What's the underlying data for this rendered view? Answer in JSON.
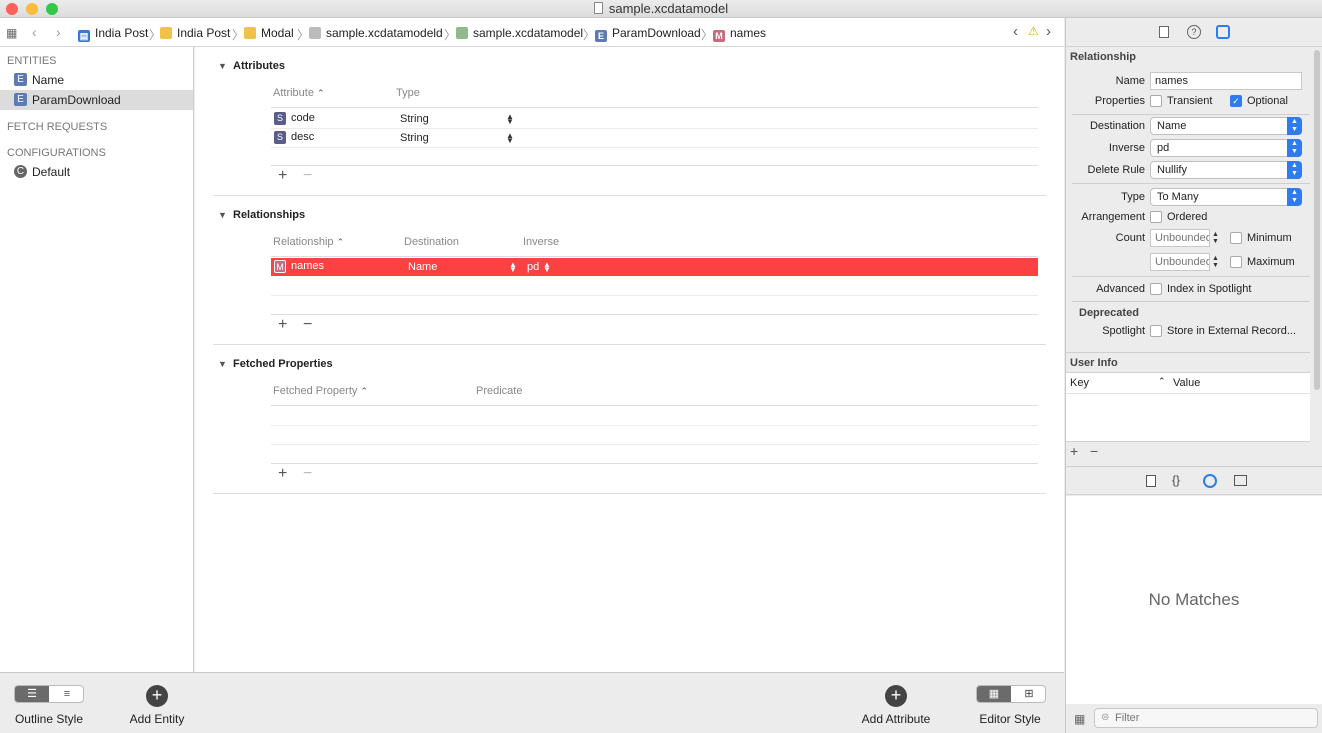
{
  "window": {
    "title": "sample.xcdatamodel"
  },
  "breadcrumbs": [
    "India Post",
    "India Post",
    "Modal",
    "sample.xcdatamodeld",
    "sample.xcdatamodel",
    "ParamDownload",
    "names"
  ],
  "sidebar": {
    "entities_header": "ENTITIES",
    "entities": [
      {
        "label": "Name",
        "icon": "E"
      },
      {
        "label": "ParamDownload",
        "icon": "E"
      }
    ],
    "fetch_requests_header": "FETCH REQUESTS",
    "configurations_header": "CONFIGURATIONS",
    "configurations": [
      {
        "label": "Default",
        "icon": "C"
      }
    ]
  },
  "attributes": {
    "title": "Attributes",
    "col_attribute": "Attribute",
    "col_type": "Type",
    "rows": [
      {
        "icon": "S",
        "name": "code",
        "type": "String"
      },
      {
        "icon": "S",
        "name": "desc",
        "type": "String"
      }
    ]
  },
  "relationships": {
    "title": "Relationships",
    "col_relationship": "Relationship",
    "col_destination": "Destination",
    "col_inverse": "Inverse",
    "rows": [
      {
        "icon": "M",
        "name": "names",
        "destination": "Name",
        "inverse": "pd"
      }
    ]
  },
  "fetched": {
    "title": "Fetched Properties",
    "col_property": "Fetched Property",
    "col_predicate": "Predicate"
  },
  "bottom": {
    "outline_style": "Outline Style",
    "add_entity": "Add Entity",
    "add_attribute": "Add Attribute",
    "editor_style": "Editor Style"
  },
  "inspector": {
    "section_title": "Relationship",
    "name_label": "Name",
    "name_value": "names",
    "properties_label": "Properties",
    "transient_label": "Transient",
    "optional_label": "Optional",
    "destination_label": "Destination",
    "destination_value": "Name",
    "inverse_label": "Inverse",
    "inverse_value": "pd",
    "delete_rule_label": "Delete Rule",
    "delete_rule_value": "Nullify",
    "type_label": "Type",
    "type_value": "To Many",
    "arrangement_label": "Arrangement",
    "ordered_label": "Ordered",
    "count_label": "Count",
    "count_placeholder": "Unbounded",
    "minimum_label": "Minimum",
    "maximum_label": "Maximum",
    "advanced_label": "Advanced",
    "index_spotlight_label": "Index in Spotlight",
    "deprecated_title": "Deprecated",
    "spotlight_label": "Spotlight",
    "store_external_label": "Store in External Record...",
    "user_info_title": "User Info",
    "key_col": "Key",
    "value_col": "Value",
    "no_matches": "No Matches",
    "filter_placeholder": "Filter"
  },
  "colors": {
    "selection_red": "#fb4141",
    "accent_blue": "#2f7cf0"
  }
}
